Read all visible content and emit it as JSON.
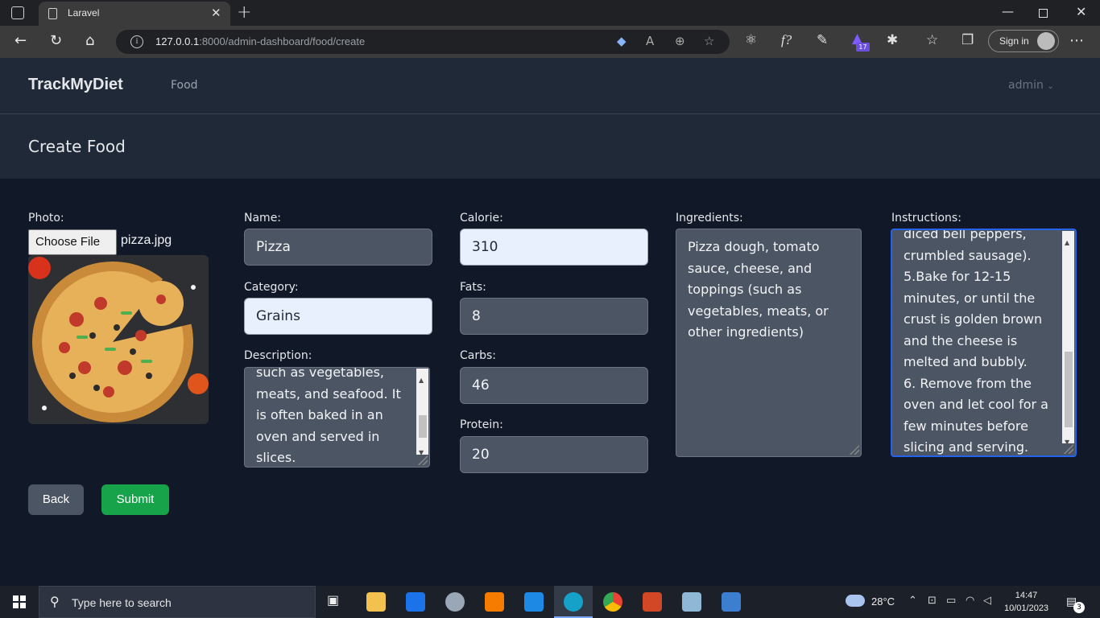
{
  "browser": {
    "tab_title": "Laravel",
    "url_host": "127.0.0.1",
    "url_rest": ":8000/admin-dashboard/food/create",
    "signin_label": "Sign in",
    "ext_badge": "17"
  },
  "nav": {
    "brand": "TrackMyDiet",
    "food_link": "Food",
    "user": "admin"
  },
  "header": {
    "title": "Create Food"
  },
  "form": {
    "photo_label": "Photo:",
    "file_button": "Choose File",
    "file_name": "pizza.jpg",
    "name_label": "Name:",
    "name_value": "Pizza",
    "category_label": "Category:",
    "category_value": "Grains",
    "description_label": "Description:",
    "description_visible": "such as vegetables,\nmeats, and seafood. It\nis often baked in an\noven and served in\nslices.",
    "calorie_label": "Calorie:",
    "calorie_value": "310",
    "fats_label": "Fats:",
    "fats_value": "8",
    "carbs_label": "Carbs:",
    "carbs_value": "46",
    "protein_label": "Protein:",
    "protein_value": "20",
    "ingredients_label": "Ingredients:",
    "ingredients_value": "Pizza dough, tomato\nsauce, cheese, and\ntoppings (such as\nvegetables, meats, or\nother ingredients)",
    "instructions_label": "Instructions:",
    "instructions_visible": "diced bell peppers,\ncrumbled sausage).\n5.Bake for 12-15\nminutes, or until the\ncrust is golden brown\nand the cheese is\nmelted and bubbly.\n6. Remove from the\noven and let cool for a\nfew minutes before\nslicing and serving.",
    "back_label": "Back",
    "submit_label": "Submit"
  },
  "taskbar": {
    "search_placeholder": "Type here to search",
    "temperature": "28°C",
    "time": "14:47",
    "date": "10/01/2023",
    "notifications": "3"
  },
  "colors": {
    "page_bg": "#111827",
    "panel_bg": "#1f2937",
    "input_bg": "#4b5563",
    "submit_bg": "#16a34a",
    "focus": "#2563eb"
  }
}
